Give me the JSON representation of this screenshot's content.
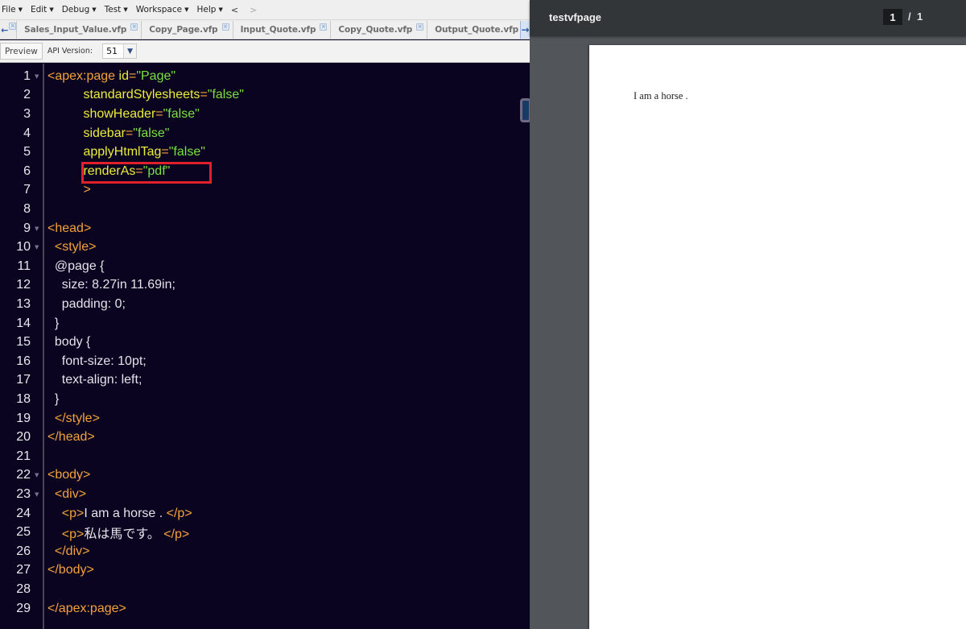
{
  "menu": {
    "items": [
      "File",
      "Edit",
      "Debug",
      "Test",
      "Workspace",
      "Help"
    ],
    "back_arrow": "<",
    "forward_arrow": ">"
  },
  "tabs": {
    "left_arrow_icon": "arrow-left",
    "items": [
      {
        "label": "Sales_Input_Value.vfp"
      },
      {
        "label": "Copy_Page.vfp"
      },
      {
        "label": "Input_Quote.vfp"
      },
      {
        "label": "Copy_Quote.vfp"
      },
      {
        "label": "Output_Quote.vfp"
      }
    ],
    "close_glyph": "×",
    "right_arrow_icon": "arrow-right"
  },
  "toolbar": {
    "preview_label": "Preview",
    "api_version_label": "API Version:",
    "api_version_value": "51"
  },
  "editor": {
    "highlighted_line": 6,
    "lines": [
      {
        "n": "1",
        "fold": true,
        "tokens": [
          [
            "tag",
            "<apex:page "
          ],
          [
            "attr",
            "id"
          ],
          [
            "tag",
            "="
          ],
          [
            "str",
            "\"Page\""
          ]
        ]
      },
      {
        "n": "2",
        "fold": false,
        "tokens": [
          [
            "txt",
            "          "
          ],
          [
            "attr",
            "standardStylesheets"
          ],
          [
            "tag",
            "="
          ],
          [
            "str",
            "\"false\""
          ]
        ]
      },
      {
        "n": "3",
        "fold": false,
        "tokens": [
          [
            "txt",
            "          "
          ],
          [
            "attr",
            "showHeader"
          ],
          [
            "tag",
            "="
          ],
          [
            "str",
            "\"false\""
          ]
        ]
      },
      {
        "n": "4",
        "fold": false,
        "tokens": [
          [
            "txt",
            "          "
          ],
          [
            "attr",
            "sidebar"
          ],
          [
            "tag",
            "="
          ],
          [
            "str",
            "\"false\""
          ]
        ]
      },
      {
        "n": "5",
        "fold": false,
        "tokens": [
          [
            "txt",
            "          "
          ],
          [
            "attr",
            "applyHtmlTag"
          ],
          [
            "tag",
            "="
          ],
          [
            "str",
            "\"false\""
          ]
        ]
      },
      {
        "n": "6",
        "fold": false,
        "tokens": [
          [
            "txt",
            "          "
          ],
          [
            "attr",
            "renderAs"
          ],
          [
            "tag",
            "="
          ],
          [
            "str",
            "\"pdf\""
          ]
        ]
      },
      {
        "n": "7",
        "fold": false,
        "tokens": [
          [
            "txt",
            "          "
          ],
          [
            "tag",
            ">"
          ]
        ]
      },
      {
        "n": "8",
        "fold": false,
        "tokens": []
      },
      {
        "n": "9",
        "fold": true,
        "tokens": [
          [
            "tag",
            "<head>"
          ]
        ]
      },
      {
        "n": "10",
        "fold": true,
        "tokens": [
          [
            "txt",
            "  "
          ],
          [
            "tag",
            "<style>"
          ]
        ]
      },
      {
        "n": "11",
        "fold": false,
        "tokens": [
          [
            "txt",
            "  @page {"
          ]
        ]
      },
      {
        "n": "12",
        "fold": false,
        "tokens": [
          [
            "txt",
            "    size: 8.27in 11.69in;"
          ]
        ]
      },
      {
        "n": "13",
        "fold": false,
        "tokens": [
          [
            "txt",
            "    padding: 0;"
          ]
        ]
      },
      {
        "n": "14",
        "fold": false,
        "tokens": [
          [
            "txt",
            "  }"
          ]
        ]
      },
      {
        "n": "15",
        "fold": false,
        "tokens": [
          [
            "txt",
            "  body {"
          ]
        ]
      },
      {
        "n": "16",
        "fold": false,
        "tokens": [
          [
            "txt",
            "    font-size: 10pt;"
          ]
        ]
      },
      {
        "n": "17",
        "fold": false,
        "tokens": [
          [
            "txt",
            "    text-align: left;"
          ]
        ]
      },
      {
        "n": "18",
        "fold": false,
        "tokens": [
          [
            "txt",
            "  }"
          ]
        ]
      },
      {
        "n": "19",
        "fold": false,
        "tokens": [
          [
            "txt",
            "  "
          ],
          [
            "tag",
            "</style>"
          ]
        ]
      },
      {
        "n": "20",
        "fold": false,
        "tokens": [
          [
            "tag",
            "</head>"
          ]
        ]
      },
      {
        "n": "21",
        "fold": false,
        "tokens": []
      },
      {
        "n": "22",
        "fold": true,
        "tokens": [
          [
            "tag",
            "<body>"
          ]
        ]
      },
      {
        "n": "23",
        "fold": true,
        "tokens": [
          [
            "txt",
            "  "
          ],
          [
            "tag",
            "<div>"
          ]
        ]
      },
      {
        "n": "24",
        "fold": false,
        "tokens": [
          [
            "txt",
            "    "
          ],
          [
            "tag",
            "<p>"
          ],
          [
            "txt",
            "I am a horse . "
          ],
          [
            "tag",
            "</p>"
          ]
        ]
      },
      {
        "n": "25",
        "fold": false,
        "tokens": [
          [
            "txt",
            "    "
          ],
          [
            "tag",
            "<p>"
          ],
          [
            "txt",
            "私は馬です。 "
          ],
          [
            "tag",
            "</p>"
          ]
        ]
      },
      {
        "n": "26",
        "fold": false,
        "tokens": [
          [
            "txt",
            "  "
          ],
          [
            "tag",
            "</div>"
          ]
        ]
      },
      {
        "n": "27",
        "fold": false,
        "tokens": [
          [
            "tag",
            "</body>"
          ]
        ]
      },
      {
        "n": "28",
        "fold": false,
        "tokens": []
      },
      {
        "n": "29",
        "fold": false,
        "tokens": [
          [
            "tag",
            "</apex:page>"
          ]
        ]
      }
    ]
  },
  "pdf_viewer": {
    "title": "testvfpage",
    "current_page": "1",
    "separator": "/",
    "total_pages": "1",
    "content": "I am a horse ."
  }
}
